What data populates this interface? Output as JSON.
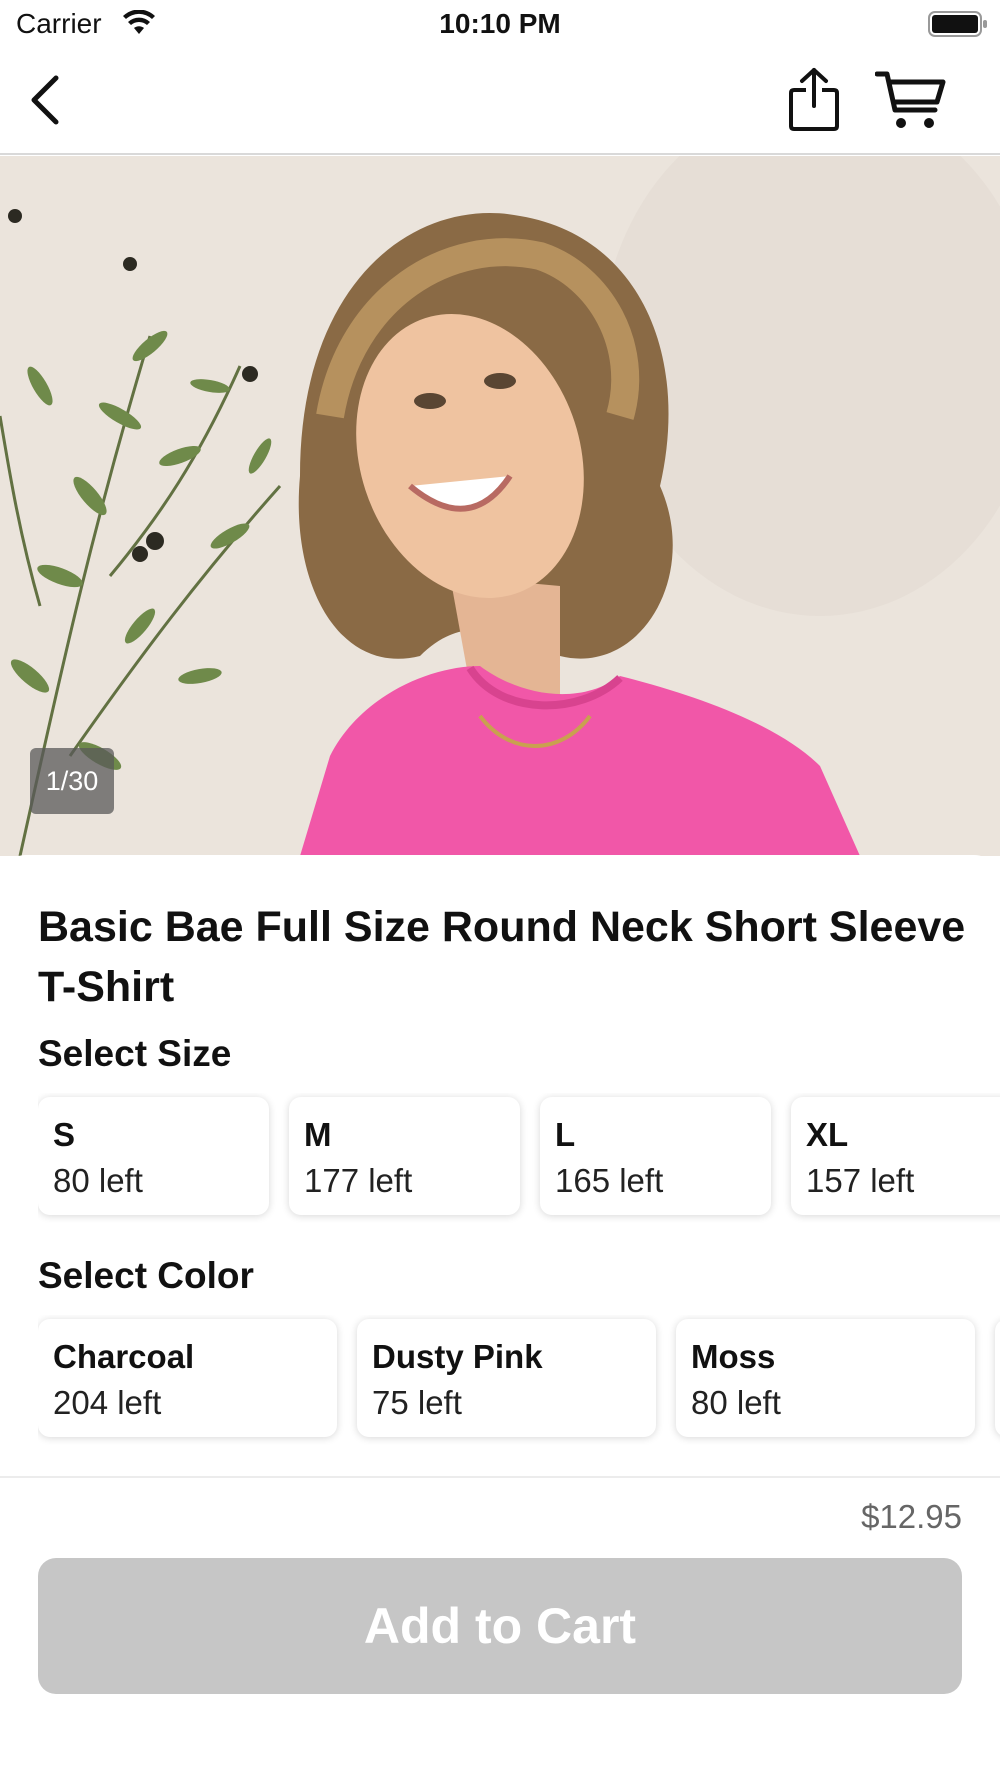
{
  "status_bar": {
    "carrier": "Carrier",
    "time": "10:10 PM"
  },
  "nav": {
    "back_icon": "chevron-left-icon",
    "share_icon": "share-icon",
    "cart_icon": "cart-icon"
  },
  "gallery": {
    "counter": "1/30"
  },
  "product": {
    "title": "Basic Bae Full Size Round Neck Short Sleeve T-Shirt",
    "size_section_label": "Select Size",
    "sizes": [
      {
        "name": "S",
        "stock": "80 left"
      },
      {
        "name": "M",
        "stock": "177 left"
      },
      {
        "name": "L",
        "stock": "165 left"
      },
      {
        "name": "XL",
        "stock": "157 left"
      }
    ],
    "color_section_label": "Select Color",
    "colors": [
      {
        "name": "Charcoal",
        "stock": "204 left"
      },
      {
        "name": "Dusty Pink",
        "stock": "75 left"
      },
      {
        "name": "Moss",
        "stock": "80 left"
      }
    ]
  },
  "footer": {
    "price": "$12.95",
    "add_to_cart_label": "Add to Cart"
  },
  "colors": {
    "button_disabled_bg": "#c6c6c6",
    "shirt_pink": "#f157a8"
  }
}
